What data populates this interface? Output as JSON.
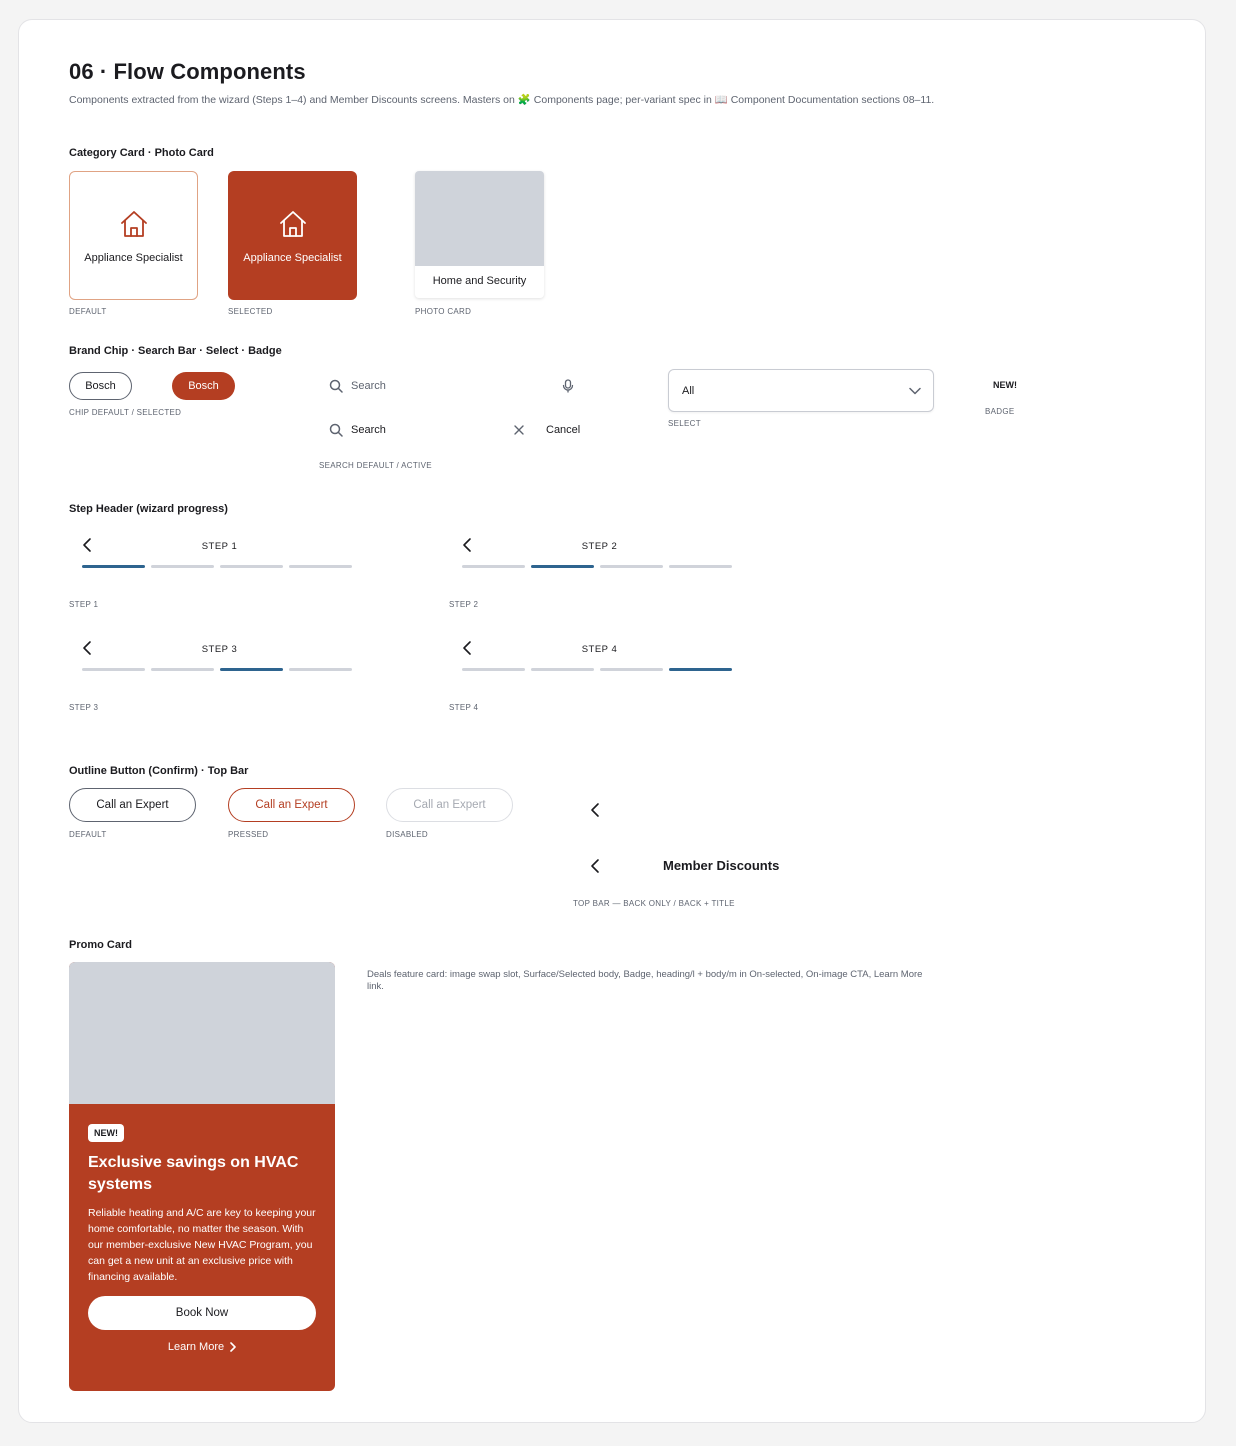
{
  "page": {
    "title": "06 · Flow Components",
    "lead": "Components extracted from the wizard (Steps 1–4) and Member Discounts screens. Masters on 🧩 Components page; per-variant spec in 📖 Component Documentation sections 08–11."
  },
  "colors": {
    "brand": "#b43e22",
    "progress_active": "#2e648f",
    "progress_inactive": "#d0d3da",
    "image_placeholder": "#cfd3da"
  },
  "category_section": {
    "title": "Category Card · Photo Card",
    "cards": [
      {
        "label": "Appliance Specialist",
        "caption": "DEFAULT",
        "icon": "house-icon"
      },
      {
        "label": "Appliance Specialist",
        "caption": "SELECTED",
        "icon": "house-icon"
      }
    ],
    "photo_card": {
      "label": "Home and Security",
      "caption": "PHOTO CARD"
    }
  },
  "chip_section": {
    "title": "Brand Chip · Search Bar · Select · Badge",
    "chips": [
      "Bosch",
      "Bosch"
    ],
    "chip_caption": "CHIP DEFAULT / SELECTED",
    "search_default": {
      "placeholder": "Search",
      "icon": "search-icon",
      "trailing_icon": "microphone-icon"
    },
    "search_active": {
      "placeholder": "Search",
      "icon": "search-icon",
      "clear_icon": "close-icon",
      "cancel_label": "Cancel"
    },
    "search_caption": "SEARCH DEFAULT / ACTIVE",
    "select": {
      "value": "All",
      "caption": "SELECT",
      "icon": "chevron-down-icon"
    },
    "badge": {
      "label": "NEW!",
      "caption": "BADGE"
    }
  },
  "step_section": {
    "title": "Step Header (wizard progress)",
    "steps": [
      {
        "title": "STEP 1",
        "caption": "STEP 1",
        "active": 0
      },
      {
        "title": "STEP 2",
        "caption": "STEP 2",
        "active": 1
      },
      {
        "title": "STEP 3",
        "caption": "STEP 3",
        "active": 2
      },
      {
        "title": "STEP 4",
        "caption": "STEP 4",
        "active": 3
      }
    ]
  },
  "button_section": {
    "title": "Outline Button (Confirm) · Top Bar",
    "buttons": [
      {
        "label": "Call an Expert",
        "caption": "DEFAULT"
      },
      {
        "label": "Call an Expert",
        "caption": "PRESSED"
      },
      {
        "label": "Call an Expert",
        "caption": "DISABLED"
      }
    ],
    "topbar": {
      "title": "Member Discounts",
      "caption": "TOP BAR — BACK ONLY / BACK + TITLE"
    }
  },
  "promo_section": {
    "title": "Promo Card",
    "badge": "NEW!",
    "heading": "Exclusive savings on HVAC systems",
    "body": "Reliable heating and A/C are key to keeping your home comfortable, no matter the season. With our member-exclusive New HVAC Program, you can get a new unit at an exclusive price with financing available.",
    "cta": "Book Now",
    "link": "Learn More",
    "note": "Deals feature card: image swap slot, Surface/Selected body, Badge, heading/l + body/m in On-selected, On-image CTA, Learn More link."
  }
}
